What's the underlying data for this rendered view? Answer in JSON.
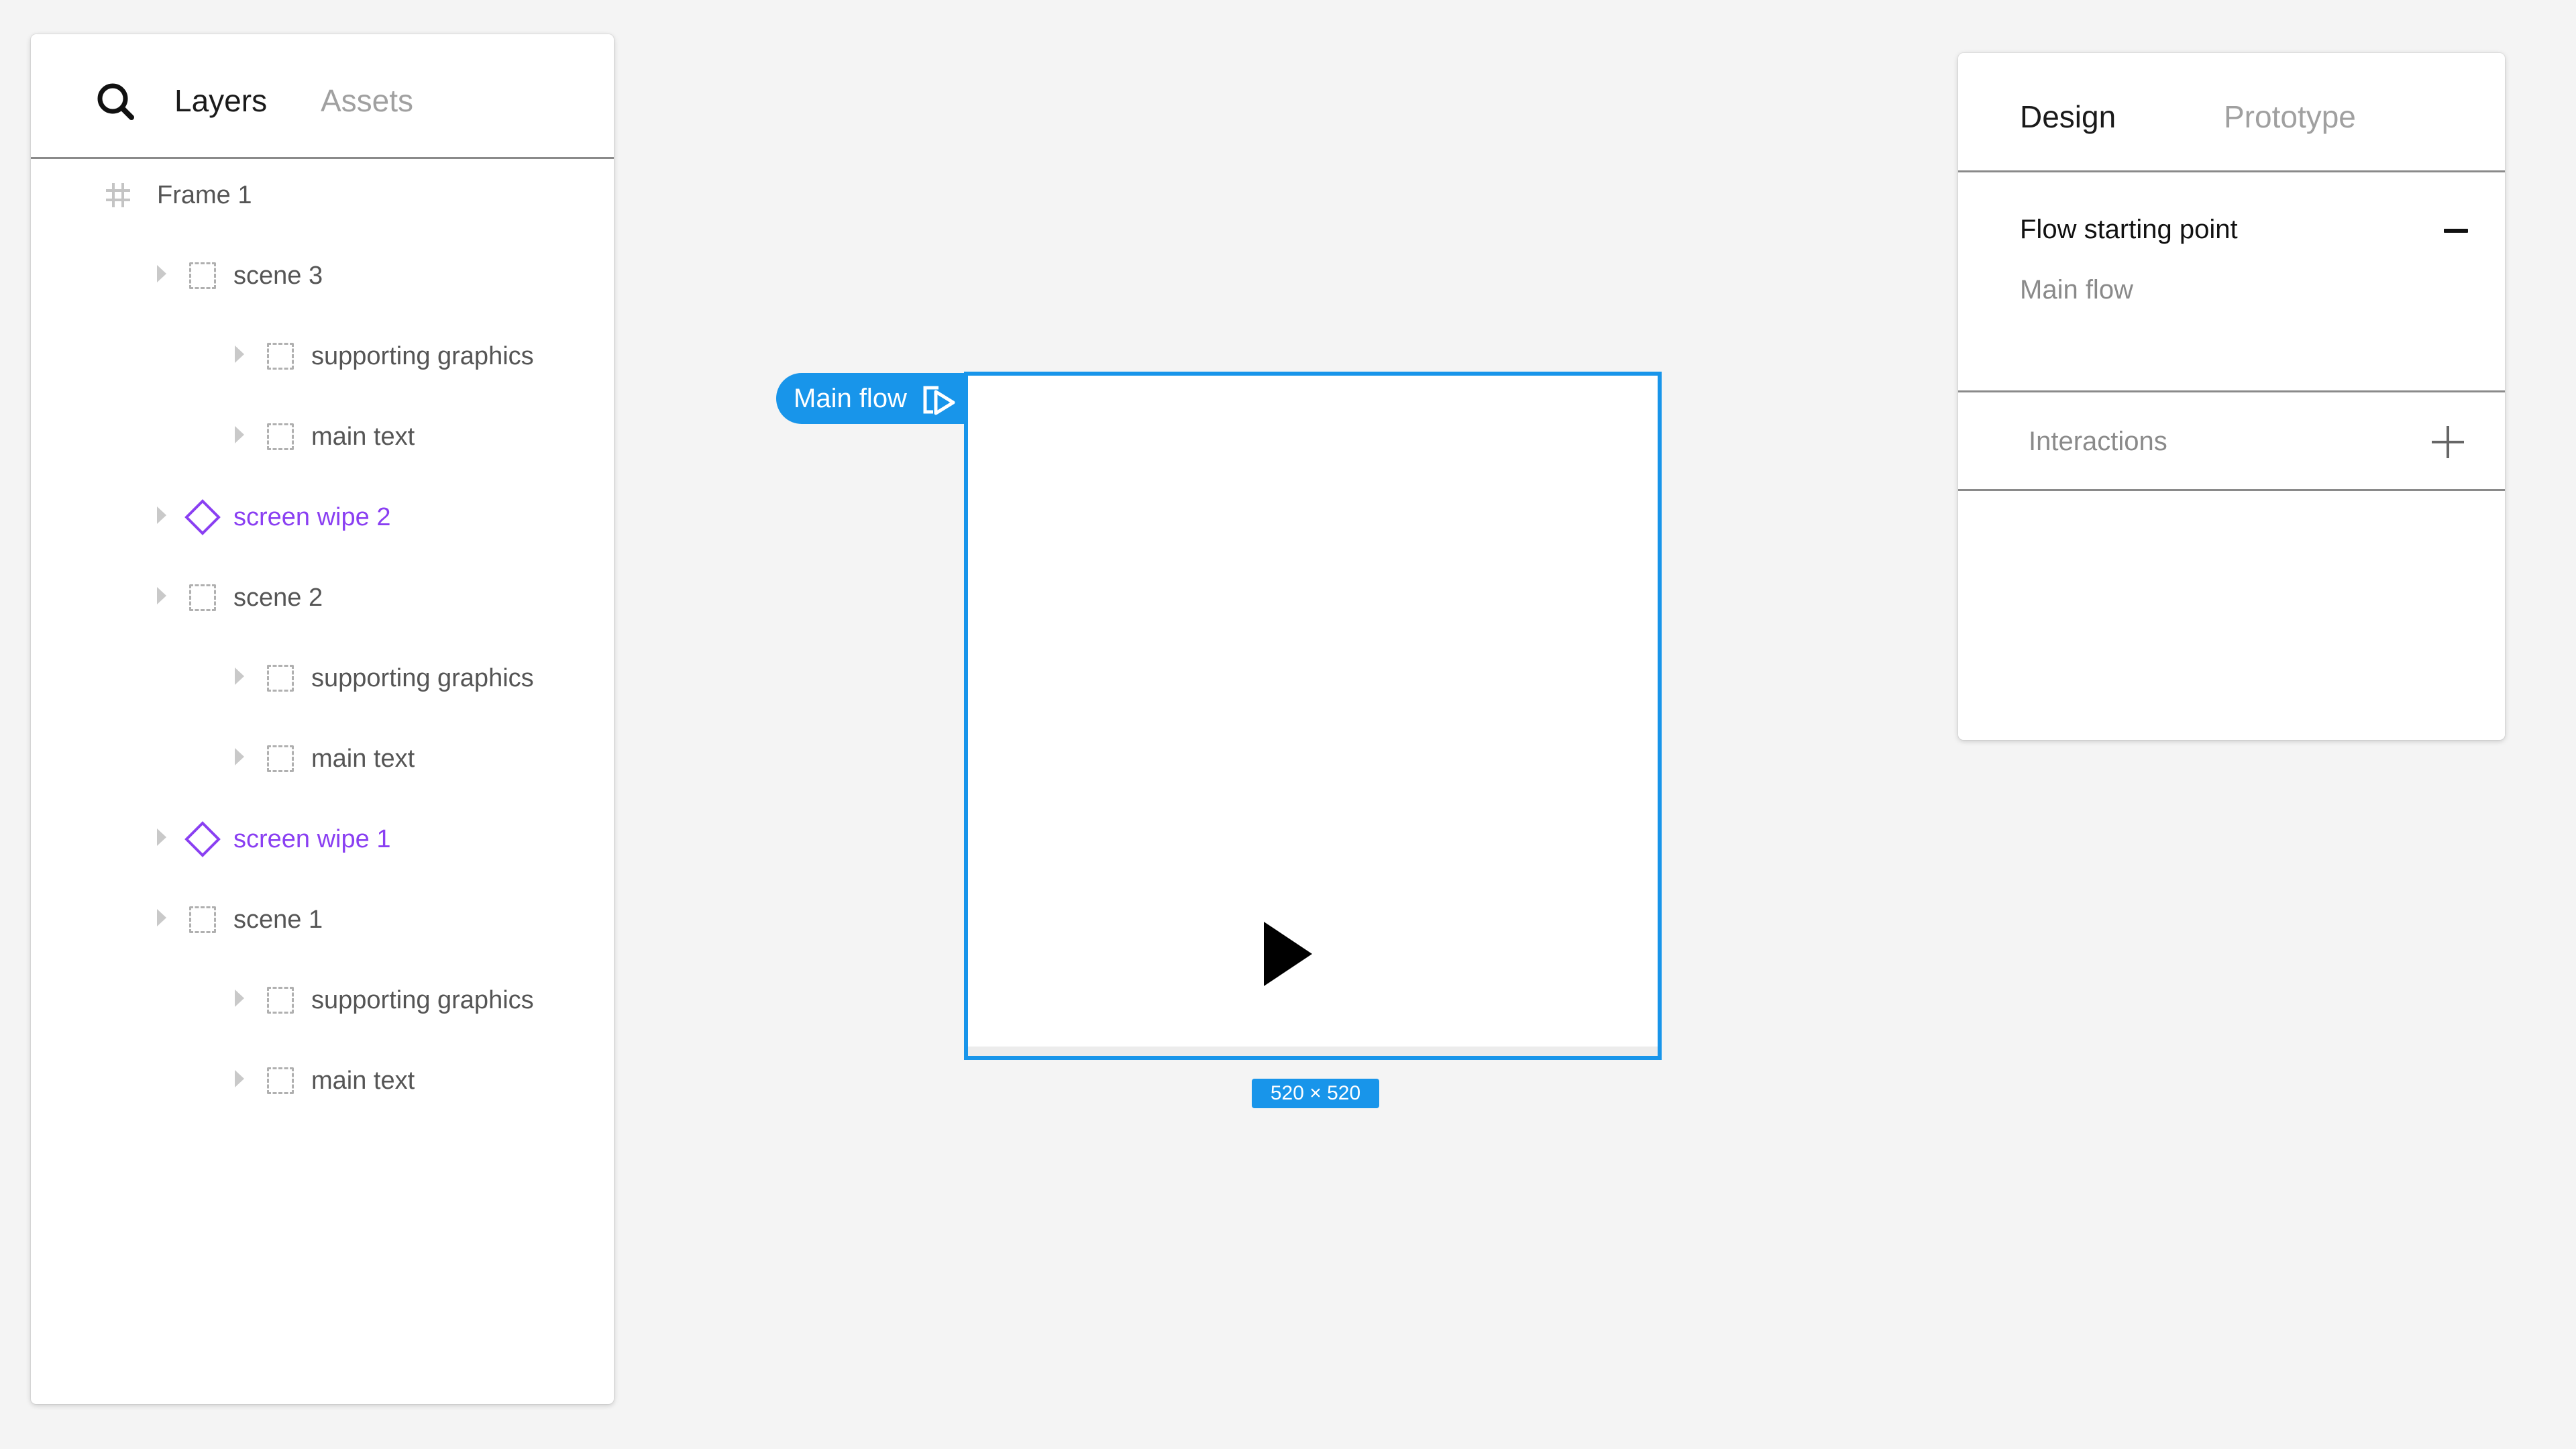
{
  "layers_panel": {
    "tabs": {
      "layers": "Layers",
      "assets": "Assets"
    },
    "items": [
      {
        "label": "Frame 1",
        "type": "frame"
      },
      {
        "label": "scene 3",
        "type": "group"
      },
      {
        "label": "supporting graphics",
        "type": "group"
      },
      {
        "label": "main text",
        "type": "group"
      },
      {
        "label": "screen wipe 2",
        "type": "component"
      },
      {
        "label": "scene 2",
        "type": "group"
      },
      {
        "label": "supporting graphics",
        "type": "group"
      },
      {
        "label": "main text",
        "type": "group"
      },
      {
        "label": "screen wipe 1",
        "type": "component"
      },
      {
        "label": "scene 1",
        "type": "group"
      },
      {
        "label": "supporting graphics",
        "type": "group"
      },
      {
        "label": "main text",
        "type": "group"
      }
    ]
  },
  "canvas": {
    "flow_tag": "Main flow",
    "frame_size": "520 × 520"
  },
  "design_panel": {
    "tabs": {
      "design": "Design",
      "prototype": "Prototype"
    },
    "flow_starting_point": {
      "title": "Flow starting point",
      "value": "Main flow"
    },
    "interactions": {
      "title": "Interactions"
    }
  },
  "colors": {
    "accent": "#1895ea",
    "component_purple": "#8a3ff2",
    "canvas_bg": "#f4f4f4"
  },
  "icons": [
    "search-icon",
    "frame-hash-icon",
    "group-icon",
    "component-diamond-icon",
    "play-flow-icon",
    "cursor-icon",
    "minus-icon",
    "plus-icon"
  ]
}
